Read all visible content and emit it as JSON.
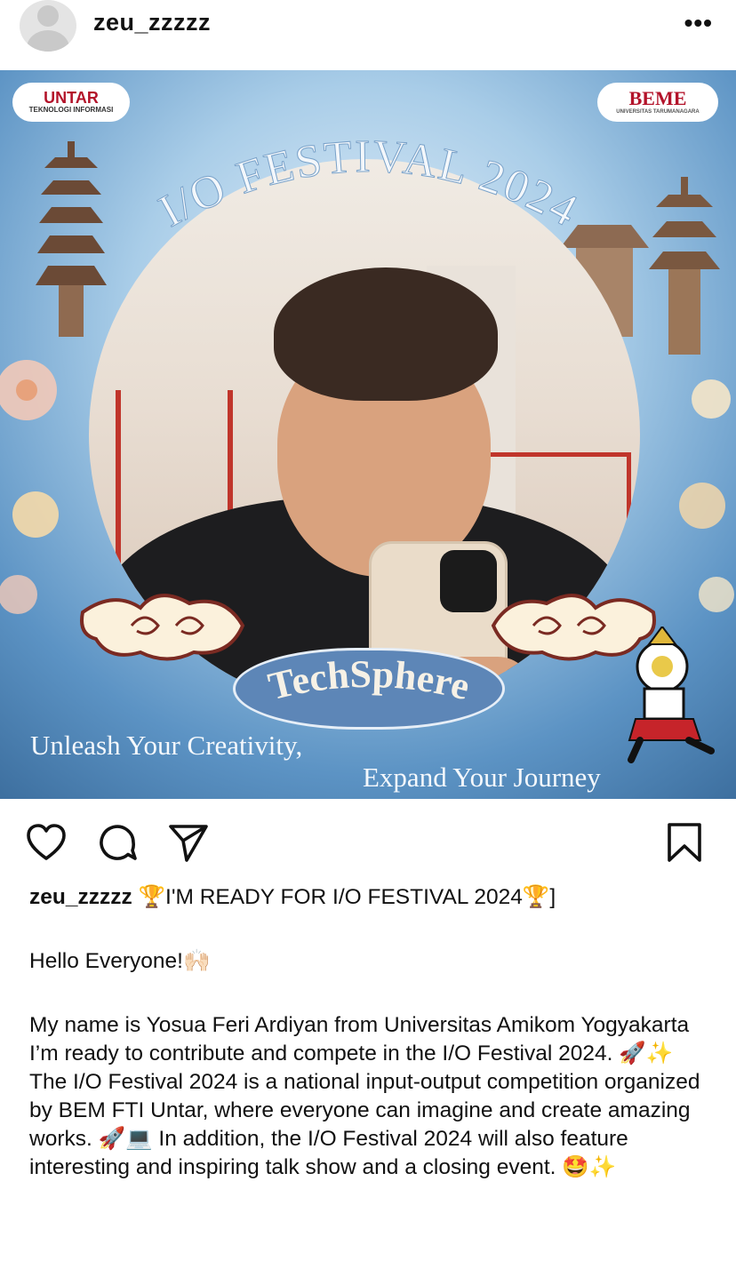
{
  "header": {
    "username": "zeu_zzzzz",
    "more_label": "•••"
  },
  "poster": {
    "badge_left_main": "UNTAR",
    "badge_left_sub": "TEKNOLOGI INFORMASI",
    "badge_right_main": "BEME",
    "badge_right_sub": "UNIVERSITAS TARUMANAGARA",
    "title": "I/O FESTIVAL 2024",
    "banner": "TechSphere",
    "tagline_1": "Unleash Your Creativity,",
    "tagline_2": "Expand Your Journey"
  },
  "actions": {
    "like_icon": "heart-icon",
    "comment_icon": "comment-icon",
    "share_icon": "send-icon",
    "save_icon": "bookmark-icon"
  },
  "caption": {
    "username": "zeu_zzzzz",
    "headline": " 🏆I'M READY FOR I/O FESTIVAL 2024🏆]",
    "greeting": "Hello Everyone!🙌🏻",
    "body": "My name is Yosua Feri Ardiyan from Universitas Amikom Yogyakarta I’m ready to contribute and compete in the  I/O Festival 2024. 🚀✨  The I/O Festival 2024 is a national input-output competition organized by BEM FTI Untar, where everyone can imagine and create amazing works. 🚀💻  In addition, the I/O Festival 2024 will also feature interesting and inspiring talk show and a closing event. 🤩✨"
  },
  "colors": {
    "poster_blue": "#5c93c4",
    "banner_blue": "#5d86b7",
    "untar_red": "#b3132a",
    "text": "#111111"
  }
}
